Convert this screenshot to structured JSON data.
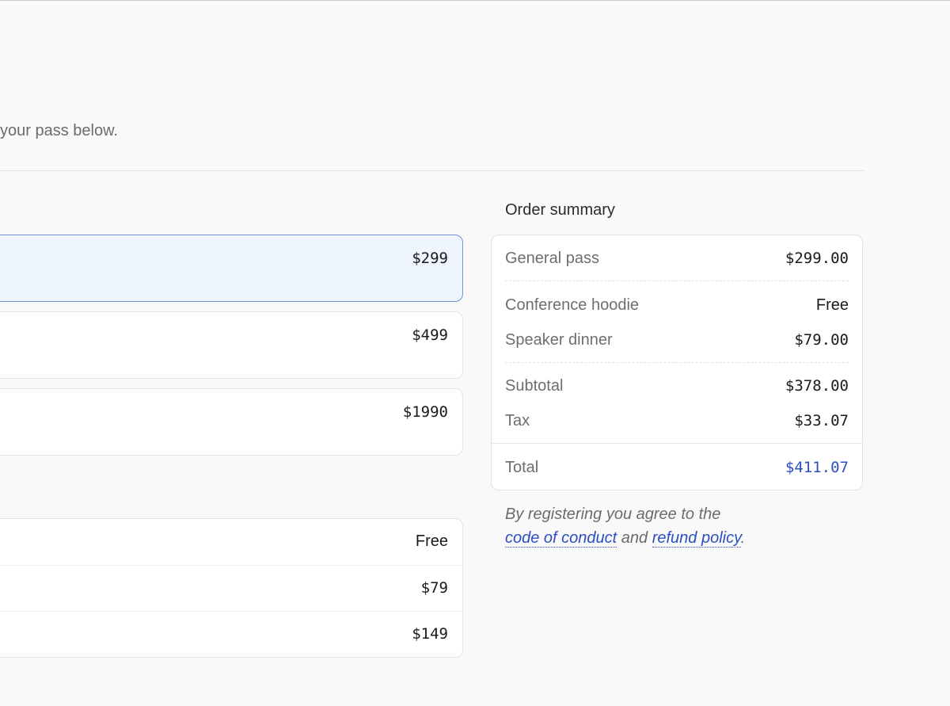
{
  "intro": {
    "text": "your pass below."
  },
  "passes": [
    {
      "price": "$299",
      "selected": true
    },
    {
      "price": "$499",
      "selected": false
    },
    {
      "price": "$1990",
      "selected": false
    }
  ],
  "addons": [
    {
      "price": "Free"
    },
    {
      "price": "$79"
    },
    {
      "price": "$149"
    }
  ],
  "summary": {
    "heading": "Order summary",
    "pass": {
      "label": "General pass",
      "value": "$299.00"
    },
    "hoodie": {
      "label": "Conference hoodie",
      "value": "Free"
    },
    "dinner": {
      "label": "Speaker dinner",
      "value": "$79.00"
    },
    "subtotal": {
      "label": "Subtotal",
      "value": "$378.00"
    },
    "tax": {
      "label": "Tax",
      "value": "$33.07"
    },
    "total": {
      "label": "Total",
      "value": "$411.07"
    }
  },
  "terms": {
    "prefix": "By registering you agree to the",
    "code_of_conduct": "code of conduct",
    "middle": "and",
    "refund_policy": "refund policy",
    "suffix": "."
  },
  "colors": {
    "accent": "#2b4fc2",
    "selected_bg": "#eef5fc",
    "selected_border": "#6f93d9",
    "page_bg": "#f9f9f9"
  }
}
